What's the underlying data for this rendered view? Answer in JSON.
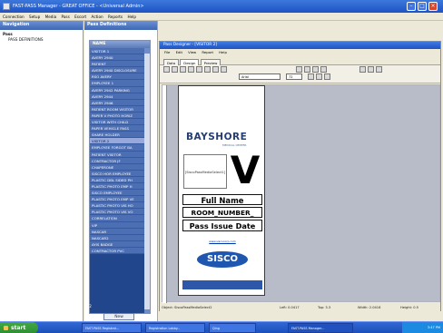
{
  "window": {
    "title": "FAST-PASS Manager - GREAT OFFICE - <Universal Admin>",
    "menu": [
      "Connection",
      "Setup",
      "Media",
      "Pass",
      "Escort",
      "Action",
      "Reports",
      "Help"
    ]
  },
  "left_panel": {
    "title": "Navigation",
    "items": [
      "Pass",
      "PASS DEFINITIONS"
    ]
  },
  "pass_definitions": {
    "title": "Pass Definitions",
    "column_header": "NAME",
    "rows": [
      "VISITOR 1",
      "AVERY 2940",
      "PATIENT",
      "AVERY 2940 DISCLOSURE",
      "RSO AVERY",
      "EMPLOYEE 1",
      "AVERY 2942 PARKING",
      "AVERY 2944",
      "AVERY 2946",
      "PATIENT ROOM VISITOR",
      "PAPER V PHOTO HORIZ",
      "VISITOR WITH CHILD",
      "PAPER VEHICLE PASS",
      "SHARE HOLDER",
      "VISITOR 2",
      "EMPLOYEE FORGOT BA",
      "PATIENT VISITOR",
      "CONTRACTOR JF",
      "CHAPERONE",
      "SISCO HOR EMPLOYEE",
      "PLASTIC DBL SIDED PH",
      "PLASTIC PHOTO EMP H",
      "SISCO EMPLOYEE",
      "PLASTIC PHOTO EMP VE",
      "PLASTIC PHOTO VIS HO",
      "PLASTIC PHOTO VIS VO",
      "CORRELATION",
      "VIP",
      "NASCAR",
      "NASCAR2",
      "AYIS BADGE",
      "CONTRACTOR PVC"
    ],
    "selected_index": 14,
    "footer_label": "F2",
    "new_button": "New"
  },
  "designer": {
    "title": "Pass Designer - [VISITOR 2]",
    "menu": [
      "File",
      "Edit",
      "View",
      "Report",
      "Help"
    ],
    "tabs": [
      "Data",
      "Design",
      "Preview"
    ],
    "active_tab": "Design",
    "font": "Arial",
    "font_size": "72",
    "card": {
      "logo_text": "BAYSHORE",
      "logo_sub": "MEDICAL CENTER",
      "media_field": "[SiscoPassMediaSelect1]",
      "big_letter": "V",
      "line1": "Full Name",
      "line2": "ROOM_NUMBER_",
      "line3": "Pass Issue Date",
      "weblink": "www.siscocorp.com",
      "sisco_logo": "SISCO"
    },
    "status": {
      "object": "Object: SiscoPassMediaSelect2",
      "left": "Left: 0.0417",
      "top": "Top: 3.3",
      "width": "Width: 2.0416",
      "height": "Height: 0.5"
    }
  },
  "taskbar": {
    "start": "start",
    "tasks": [
      "FAST-PASS Registrat...",
      "Registration Lobby...",
      "Qing",
      "FAST-PASS Manager..."
    ],
    "clock": "3:47 PM"
  }
}
